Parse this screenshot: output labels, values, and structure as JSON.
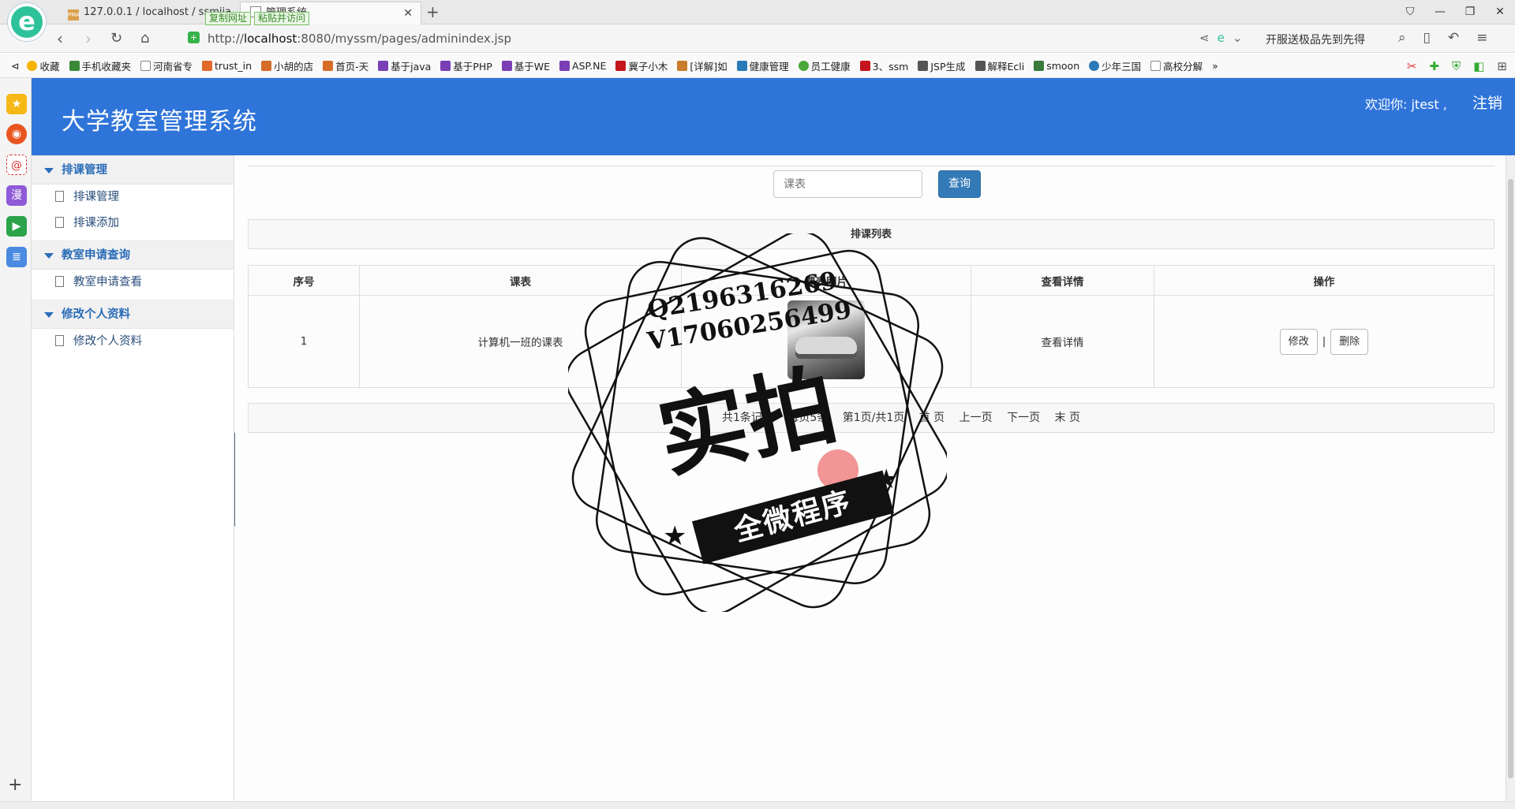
{
  "browser": {
    "tabs": [
      {
        "label": "127.0.0.1 / localhost / ssmjia",
        "favicon_text": "PMA"
      },
      {
        "label": "管理系统"
      }
    ],
    "clip_buttons": [
      "复制网址",
      "粘贴并访问"
    ],
    "url_host": "localhost",
    "url_prefix": "http://",
    "url_rest": ":8080/myssm/pages/adminindex.jsp",
    "promo_text": "开服送极品先到先得",
    "bookmarks": [
      "收藏",
      "手机收藏夹",
      "河南省专",
      "trust_in",
      "小胡的店",
      "首页-天",
      "基于java",
      "基于PHP",
      "基于WE",
      "ASP.NE",
      "冀子小木",
      "[详解]如",
      "健康管理",
      "员工健康",
      "3、ssm",
      "JSP生成",
      "解释Ecli",
      "smoon",
      "少年三国",
      "高校分解"
    ],
    "bookmark_more": "»"
  },
  "header": {
    "title": "大学教室管理系统",
    "welcome": "欢迎你: jtest ,",
    "logout": "注销"
  },
  "sidebar": {
    "groups": [
      {
        "title": "排课管理",
        "items": [
          "排课管理",
          "排课添加"
        ]
      },
      {
        "title": "教室申请查询",
        "items": [
          "教室申请查看"
        ]
      },
      {
        "title": "修改个人资料",
        "items": [
          "修改个人资料"
        ]
      }
    ]
  },
  "search": {
    "placeholder": "课表",
    "button": "查询"
  },
  "list": {
    "title": "排课列表",
    "columns": [
      "序号",
      "课表",
      "课表图片",
      "查看详情",
      "操作"
    ],
    "rows": [
      {
        "index": "1",
        "schedule": "计算机一班的课表",
        "detail": "查看详情",
        "edit": "修改",
        "sep": "|",
        "delete": "删除"
      }
    ]
  },
  "pager": {
    "items": [
      "共1条记录",
      "每页5条",
      "第1页/共1页",
      "首 页",
      "上一页",
      "下一页",
      "末 页"
    ]
  },
  "watermark": {
    "line1": "Q2196316269",
    "line2": "V17060256499",
    "big": "实拍",
    "ribbon": "全微程序"
  }
}
